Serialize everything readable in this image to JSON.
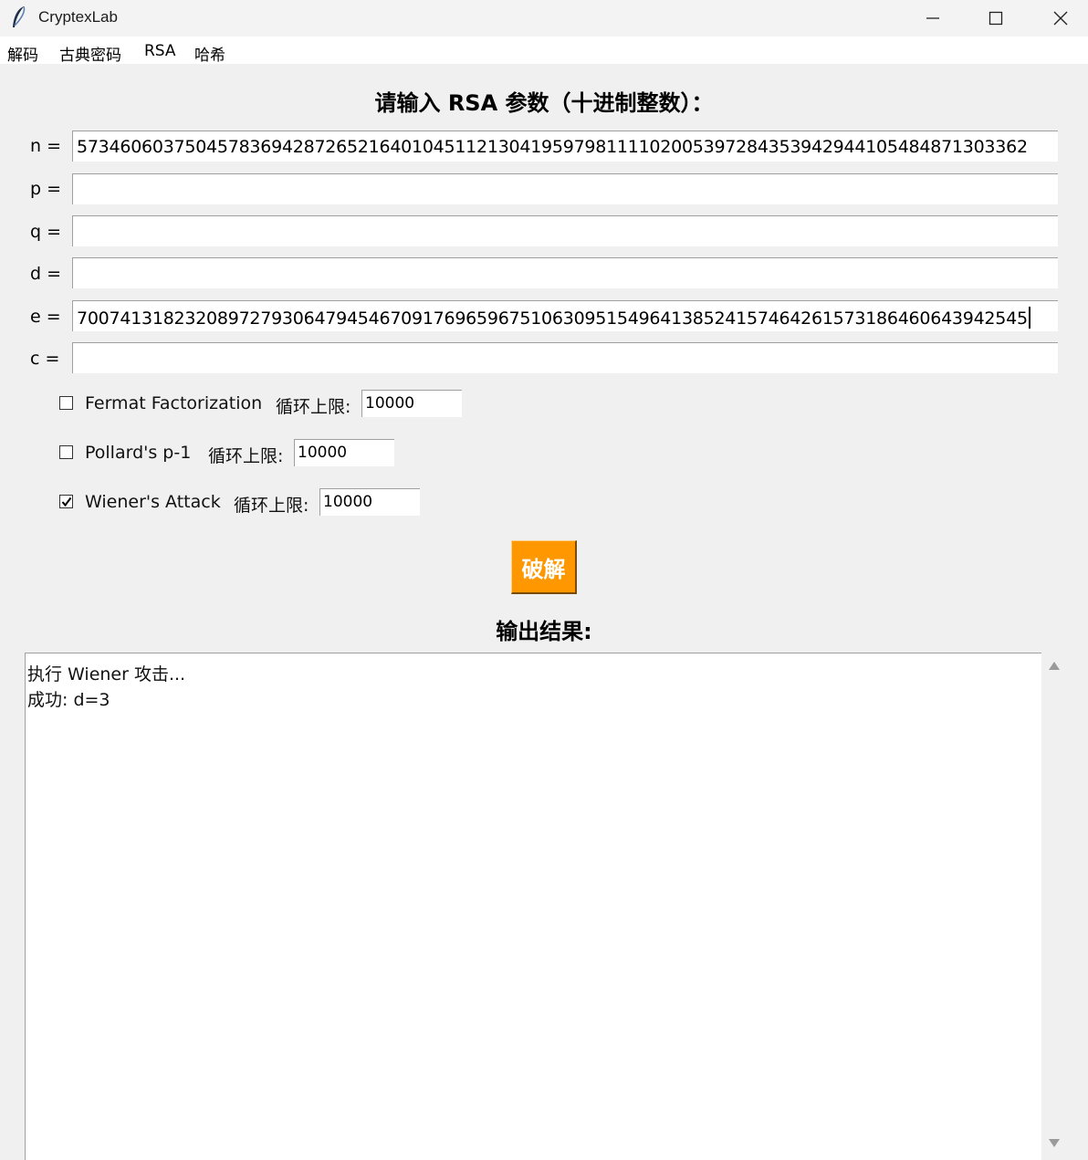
{
  "window": {
    "title": "CryptexLab",
    "app_icon": "feather-icon",
    "controls": [
      "minimize-icon",
      "maximize-icon",
      "close-icon"
    ]
  },
  "menu": [
    "解码",
    "古典密码",
    "RSA",
    "哈希"
  ],
  "form": {
    "heading": "请输入 RSA 参数（十进制整数）：",
    "fields": [
      {
        "label": "n =",
        "value": "5734606037504578369428726521640104511213041959798111102005397284353942944105484871303362"
      },
      {
        "label": "p =",
        "value": ""
      },
      {
        "label": "q =",
        "value": ""
      },
      {
        "label": "d =",
        "value": ""
      },
      {
        "label": "e =",
        "value": "7007413182320897279306479454670917696596751063095154964138524157464261573186460643942545"
      },
      {
        "label": "c =",
        "value": ""
      }
    ]
  },
  "options": [
    {
      "label": "Fermat Factorization",
      "checked": false,
      "limit_label": "循环上限:",
      "limit": "10000"
    },
    {
      "label": "Pollard's p-1",
      "checked": false,
      "limit_label": "循环上限:",
      "limit": "10000"
    },
    {
      "label": "Wiener's Attack",
      "checked": true,
      "limit_label": "循环上限:",
      "limit": "10000"
    }
  ],
  "crack_button": "破解",
  "output": {
    "heading": "输出结果:",
    "lines": [
      "执行 Wiener 攻击...",
      "成功: d=3"
    ]
  },
  "colors": {
    "accent": "#ff9800",
    "window_bg": "#f0f0f0"
  }
}
